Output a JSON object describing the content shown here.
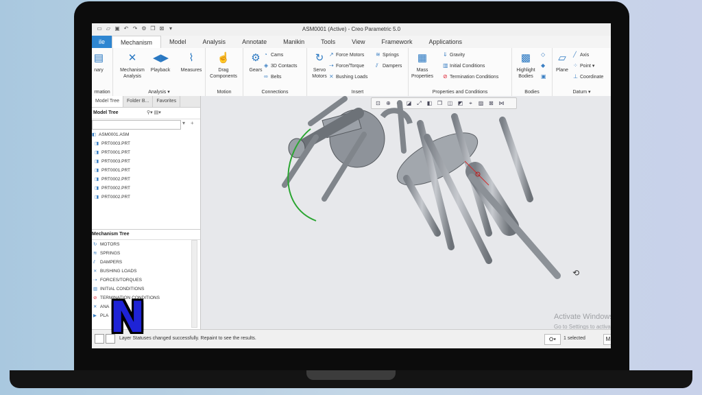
{
  "window": {
    "title": "ASM0001 (Active) - Creo Parametric 5.0"
  },
  "quick_access": {
    "icons": [
      "new-icon",
      "open-icon",
      "save-icon",
      "undo-icon",
      "redo-icon",
      "regenerate-icon",
      "windows-icon",
      "close-icon",
      "customize-icon"
    ]
  },
  "tabs": [
    "ile",
    "Mechanism",
    "Model",
    "Analysis",
    "Annotate",
    "Manikin",
    "Tools",
    "View",
    "Framework",
    "Applications"
  ],
  "ribbon": {
    "g1": {
      "label": "rmation",
      "button": "nary"
    },
    "analysis": {
      "label": "Analysis ▾",
      "mech": "Mechanism Analysis",
      "playback": "Playback",
      "measures": "Measures"
    },
    "motion": {
      "label": "Motion",
      "drag": "Drag Components"
    },
    "connections": {
      "label": "Connections",
      "gears": "Gears",
      "cams": "Cams",
      "contacts": "3D Contacts",
      "belts": "Belts"
    },
    "insert": {
      "label": "Insert",
      "servo": "Servo Motors",
      "force_motors": "Force Motors",
      "force_torque": "Force/Torque",
      "bushing": "Bushing Loads",
      "springs": "Springs",
      "dampers": "Dampers"
    },
    "props": {
      "label": "Properties and Conditions",
      "mass": "Mass Properties",
      "gravity": "Gravity",
      "initial": "Initial Conditions",
      "termination": "Termination Conditions"
    },
    "bodies": {
      "label": "Bodies",
      "highlight": "Highlight Bodies"
    },
    "datum": {
      "label": "Datum ▾",
      "plane": "Plane",
      "axis": "Axis",
      "point": "Point ▾",
      "coord": "Coordinate"
    }
  },
  "panel": {
    "tabs": [
      "Model Tree",
      "Folder B...",
      "Favorites"
    ],
    "model_tree_title": "Model Tree",
    "items": [
      "ASM0001.ASM",
      "PRT0003.PRT",
      "PRT0001.PRT",
      "PRT0003.PRT",
      "PRT0001.PRT",
      "PRT0002.PRT",
      "PRT0002.PRT",
      "PRT0002.PRT"
    ],
    "mech_title": "Mechanism Tree",
    "mech_items": [
      "MOTORS",
      "SPRINGS",
      "DAMPERS",
      "BUSHING LOADS",
      "FORCES/TORQUES",
      "INITIAL CONDITIONS",
      "TERMINATION CONDITIONS",
      "ANA",
      "PLA"
    ]
  },
  "status": {
    "message": "Layer Statuses changed successfully. Repaint to see the results.",
    "selected": "1 selected",
    "m": "M"
  },
  "watermark": {
    "line1": "Activate Windows",
    "line2": "Go to Settings to activate Windows."
  },
  "logo": {
    "letter": "N"
  }
}
